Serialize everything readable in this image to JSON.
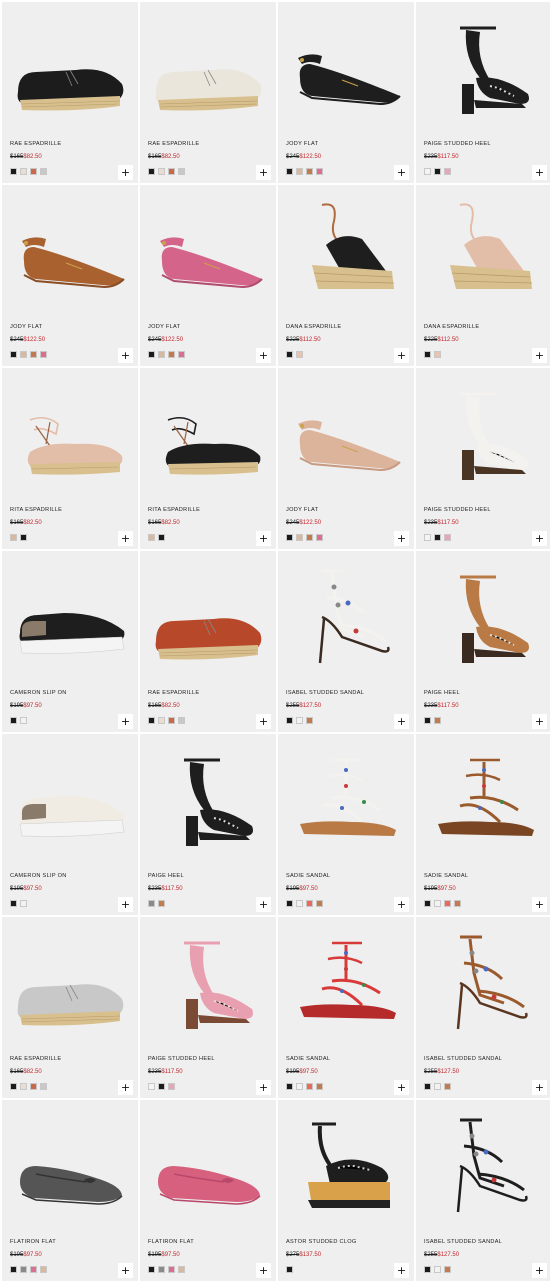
{
  "add_label": "+",
  "products": [
    {
      "name": "RAE ESPADRILLE",
      "was": "$165",
      "now": "$82.50",
      "icon": "espadrille-icon",
      "colors": [
        "#1a1a1a",
        "#e8ddd0",
        "#c9694a",
        "#c8c8c8"
      ],
      "shoe": {
        "type": "espadrille",
        "main": "#1c1c1c",
        "sole": "#d8c08e"
      }
    },
    {
      "name": "RAE ESPADRILLE",
      "was": "$165",
      "now": "$82.50",
      "icon": "espadrille-icon",
      "colors": [
        "#1a1a1a",
        "#e8ddd0",
        "#c9694a",
        "#c8c8c8"
      ],
      "shoe": {
        "type": "espadrille",
        "main": "#ebe6dc",
        "sole": "#d8c08e"
      }
    },
    {
      "name": "JODY FLAT",
      "was": "$245",
      "now": "$122.50",
      "icon": "flat-shoe-icon",
      "colors": [
        "#1a1a1a",
        "#d9b8a0",
        "#c27a4f",
        "#d9708f"
      ],
      "shoe": {
        "type": "pointed-flat",
        "main": "#1e1e1e",
        "sole": "#1e1e1e"
      }
    },
    {
      "name": "PAIGE STUDDED HEEL",
      "was": "$235",
      "now": "$117.50",
      "icon": "heel-icon",
      "colors": [
        "#f4f4f4",
        "#1a1a1a",
        "#e8a5b5"
      ],
      "shoe": {
        "type": "block-heel",
        "main": "#1e1e1e",
        "sole": "#1e1e1e"
      }
    },
    {
      "name": "JODY FLAT",
      "was": "$245",
      "now": "$122.50",
      "icon": "flat-shoe-icon",
      "colors": [
        "#1a1a1a",
        "#d9b8a0",
        "#c27a4f",
        "#d9708f"
      ],
      "shoe": {
        "type": "pointed-flat",
        "main": "#a8612f",
        "sole": "#8a4e25"
      }
    },
    {
      "name": "JODY FLAT",
      "was": "$245",
      "now": "$122.50",
      "icon": "flat-shoe-icon",
      "colors": [
        "#1a1a1a",
        "#d9b8a0",
        "#c27a4f",
        "#d9708f"
      ],
      "shoe": {
        "type": "pointed-flat",
        "main": "#d4648a",
        "sole": "#b24c70"
      }
    },
    {
      "name": "DANA ESPADRILLE",
      "was": "$225",
      "now": "$112.50",
      "icon": "wedge-icon",
      "colors": [
        "#1a1a1a",
        "#e8c4b0"
      ],
      "shoe": {
        "type": "wedge",
        "main": "#1e1e1e",
        "sole": "#d8c08e"
      }
    },
    {
      "name": "DANA ESPADRILLE",
      "was": "$225",
      "now": "$112.50",
      "icon": "wedge-icon",
      "colors": [
        "#1a1a1a",
        "#e8c4b0"
      ],
      "shoe": {
        "type": "wedge",
        "main": "#e2bda8",
        "sole": "#d8c08e"
      }
    },
    {
      "name": "RITA ESPADRILLE",
      "was": "$165",
      "now": "$82.50",
      "icon": "espadrille-icon",
      "colors": [
        "#d9b8a0",
        "#1a1a1a"
      ],
      "shoe": {
        "type": "lace-espadrille",
        "main": "#e2bda8",
        "sole": "#d8c08e"
      }
    },
    {
      "name": "RITA ESPADRILLE",
      "was": "$165",
      "now": "$82.50",
      "icon": "espadrille-icon",
      "colors": [
        "#d9b8a0",
        "#1a1a1a"
      ],
      "shoe": {
        "type": "lace-espadrille",
        "main": "#1e1e1e",
        "sole": "#d8c08e"
      }
    },
    {
      "name": "JODY FLAT",
      "was": "$245",
      "now": "$122.50",
      "icon": "flat-shoe-icon",
      "colors": [
        "#1a1a1a",
        "#d9b8a0",
        "#c27a4f",
        "#d9708f"
      ],
      "shoe": {
        "type": "pointed-flat",
        "main": "#dcb49c",
        "sole": "#c89a80"
      }
    },
    {
      "name": "PAIGE STUDDED HEEL",
      "was": "$235",
      "now": "$117.50",
      "icon": "heel-icon",
      "colors": [
        "#f4f4f4",
        "#1a1a1a",
        "#e8a5b5"
      ],
      "shoe": {
        "type": "block-heel",
        "main": "#f4f2ee",
        "sole": "#4a3525"
      }
    },
    {
      "name": "CAMERON SLIP ON",
      "was": "$195",
      "now": "$97.50",
      "icon": "sneaker-icon",
      "colors": [
        "#1a1a1a",
        "#f2f2f2"
      ],
      "shoe": {
        "type": "slip-on",
        "main": "#1e1e1e",
        "sole": "#f4f4f4"
      }
    },
    {
      "name": "RAE ESPADRILLE",
      "was": "$165",
      "now": "$82.50",
      "icon": "espadrille-icon",
      "colors": [
        "#1a1a1a",
        "#e8ddd0",
        "#c9694a",
        "#c8c8c8"
      ],
      "shoe": {
        "type": "espadrille",
        "main": "#b8482a",
        "sole": "#d8c08e"
      }
    },
    {
      "name": "ISABEL STUDDED SANDAL",
      "was": "$255",
      "now": "$127.50",
      "icon": "sandal-icon",
      "colors": [
        "#1a1a1a",
        "#f2f2f2",
        "#c27a4f"
      ],
      "shoe": {
        "type": "stiletto-sandal",
        "main": "#f4f2ee",
        "sole": "#3a2a20"
      }
    },
    {
      "name": "PAIGE HEEL",
      "was": "$235",
      "now": "$117.50",
      "icon": "heel-icon",
      "colors": [
        "#1a1a1a",
        "#c27a4f"
      ],
      "shoe": {
        "type": "block-heel",
        "main": "#b97a45",
        "sole": "#3a2a20"
      }
    },
    {
      "name": "CAMERON SLIP ON",
      "was": "$195",
      "now": "$97.50",
      "icon": "sneaker-icon",
      "colors": [
        "#1a1a1a",
        "#f2f2f2"
      ],
      "shoe": {
        "type": "slip-on",
        "main": "#f0ece4",
        "sole": "#f4f4f4"
      }
    },
    {
      "name": "PAIGE HEEL",
      "was": "$235",
      "now": "$117.50",
      "icon": "heel-icon",
      "colors": [
        "#8a8a8a",
        "#c27a4f"
      ],
      "shoe": {
        "type": "block-heel",
        "main": "#1e1e1e",
        "sole": "#1e1e1e"
      }
    },
    {
      "name": "SADIE SANDAL",
      "was": "$195",
      "now": "$97.50",
      "icon": "sandal-icon",
      "colors": [
        "#1a1a1a",
        "#f2f2f2",
        "#e86a5a",
        "#c27a4f"
      ],
      "shoe": {
        "type": "flat-sandal",
        "main": "#f4f2ee",
        "sole": "#b97a45"
      }
    },
    {
      "name": "SADIE SANDAL",
      "was": "$195",
      "now": "$97.50",
      "icon": "sandal-icon",
      "colors": [
        "#1a1a1a",
        "#f2f2f2",
        "#e86a5a",
        "#c27a4f"
      ],
      "shoe": {
        "type": "flat-sandal",
        "main": "#9a5a2c",
        "sole": "#7a4522"
      }
    },
    {
      "name": "RAE ESPADRILLE",
      "was": "$165",
      "now": "$82.50",
      "icon": "espadrille-icon",
      "colors": [
        "#1a1a1a",
        "#e8ddd0",
        "#c9694a",
        "#c8c8c8"
      ],
      "shoe": {
        "type": "espadrille",
        "main": "#c8c8c8",
        "sole": "#d8c08e"
      }
    },
    {
      "name": "PAIGE STUDDED HEEL",
      "was": "$235",
      "now": "$117.50",
      "icon": "heel-icon",
      "colors": [
        "#f4f4f4",
        "#1a1a1a",
        "#e8a5b5"
      ],
      "shoe": {
        "type": "block-heel",
        "main": "#e8a0b0",
        "sole": "#7a4a35"
      }
    },
    {
      "name": "SADIE SANDAL",
      "was": "$195",
      "now": "$97.50",
      "icon": "sandal-icon",
      "colors": [
        "#1a1a1a",
        "#f2f2f2",
        "#e86a5a",
        "#c27a4f"
      ],
      "shoe": {
        "type": "flat-sandal",
        "main": "#d83a3a",
        "sole": "#b52a2a"
      }
    },
    {
      "name": "ISABEL STUDDED SANDAL",
      "was": "$255",
      "now": "$127.50",
      "icon": "sandal-icon",
      "colors": [
        "#1a1a1a",
        "#f2f2f2",
        "#c27a4f"
      ],
      "shoe": {
        "type": "stiletto-sandal",
        "main": "#9a5a2c",
        "sole": "#5a3520"
      }
    },
    {
      "name": "FLATIRON FLAT",
      "was": "$195",
      "now": "$97.50",
      "icon": "ballet-flat-icon",
      "colors": [
        "#1a1a1a",
        "#8a8a8a",
        "#d9708f",
        "#d9b8a0"
      ],
      "shoe": {
        "type": "ballet-flat",
        "main": "#555555",
        "sole": "#333333"
      }
    },
    {
      "name": "FLATIRON FLAT",
      "was": "$195",
      "now": "$97.50",
      "icon": "ballet-flat-icon",
      "colors": [
        "#1a1a1a",
        "#8a8a8a",
        "#d9708f",
        "#d9b8a0"
      ],
      "shoe": {
        "type": "ballet-flat",
        "main": "#d8607f",
        "sole": "#b8486a"
      }
    },
    {
      "name": "ASTOR STUDDED CLOG",
      "was": "$275",
      "now": "$137.50",
      "icon": "clog-icon",
      "colors": [
        "#1a1a1a"
      ],
      "shoe": {
        "type": "clog",
        "main": "#1e1e1e",
        "sole": "#d9a24a"
      }
    },
    {
      "name": "ISABEL STUDDED SANDAL",
      "was": "$255",
      "now": "$127.50",
      "icon": "sandal-icon",
      "colors": [
        "#1a1a1a",
        "#f2f2f2",
        "#c27a4f"
      ],
      "shoe": {
        "type": "stiletto-sandal",
        "main": "#1e1e1e",
        "sole": "#1e1e1e"
      }
    }
  ]
}
